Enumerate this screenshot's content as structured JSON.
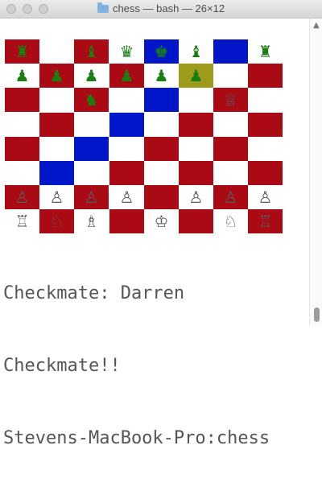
{
  "window": {
    "title": "chess — bash — 26×12"
  },
  "board": {
    "rows": [
      [
        {
          "bg": "r",
          "p": "♜",
          "c": "g"
        },
        {
          "bg": "w",
          "p": "",
          "c": ""
        },
        {
          "bg": "r",
          "p": "♝",
          "c": "g"
        },
        {
          "bg": "w",
          "p": "♛",
          "c": "g"
        },
        {
          "bg": "b",
          "p": "♚",
          "c": "g"
        },
        {
          "bg": "w",
          "p": "♝",
          "c": "g"
        },
        {
          "bg": "b",
          "p": "",
          "c": ""
        },
        {
          "bg": "w",
          "p": "♜",
          "c": "g"
        }
      ],
      [
        {
          "bg": "w",
          "p": "♟",
          "c": "g"
        },
        {
          "bg": "r",
          "p": "♟",
          "c": "g"
        },
        {
          "bg": "w",
          "p": "♟",
          "c": "g"
        },
        {
          "bg": "r",
          "p": "♟",
          "c": "g"
        },
        {
          "bg": "w",
          "p": "♟",
          "c": "g"
        },
        {
          "bg": "o",
          "p": "♟",
          "c": "g"
        },
        {
          "bg": "w",
          "p": "",
          "c": ""
        },
        {
          "bg": "r",
          "p": "",
          "c": ""
        }
      ],
      [
        {
          "bg": "r",
          "p": "",
          "c": ""
        },
        {
          "bg": "w",
          "p": "",
          "c": ""
        },
        {
          "bg": "r",
          "p": "♞",
          "c": "g"
        },
        {
          "bg": "w",
          "p": "",
          "c": ""
        },
        {
          "bg": "b",
          "p": "",
          "c": ""
        },
        {
          "bg": "w",
          "p": "",
          "c": ""
        },
        {
          "bg": "r",
          "p": "♕",
          "c": "k"
        },
        {
          "bg": "w",
          "p": "",
          "c": ""
        }
      ],
      [
        {
          "bg": "w",
          "p": "",
          "c": ""
        },
        {
          "bg": "r",
          "p": "",
          "c": ""
        },
        {
          "bg": "w",
          "p": "",
          "c": ""
        },
        {
          "bg": "b",
          "p": "",
          "c": ""
        },
        {
          "bg": "w",
          "p": "",
          "c": ""
        },
        {
          "bg": "r",
          "p": "",
          "c": ""
        },
        {
          "bg": "w",
          "p": "",
          "c": ""
        },
        {
          "bg": "r",
          "p": "",
          "c": ""
        }
      ],
      [
        {
          "bg": "r",
          "p": "",
          "c": ""
        },
        {
          "bg": "w",
          "p": "",
          "c": ""
        },
        {
          "bg": "b",
          "p": "",
          "c": ""
        },
        {
          "bg": "w",
          "p": "",
          "c": ""
        },
        {
          "bg": "r",
          "p": "",
          "c": ""
        },
        {
          "bg": "w",
          "p": "",
          "c": ""
        },
        {
          "bg": "r",
          "p": "",
          "c": ""
        },
        {
          "bg": "w",
          "p": "",
          "c": ""
        }
      ],
      [
        {
          "bg": "w",
          "p": "",
          "c": ""
        },
        {
          "bg": "b",
          "p": "",
          "c": ""
        },
        {
          "bg": "w",
          "p": "",
          "c": ""
        },
        {
          "bg": "r",
          "p": "",
          "c": ""
        },
        {
          "bg": "w",
          "p": "",
          "c": ""
        },
        {
          "bg": "r",
          "p": "",
          "c": ""
        },
        {
          "bg": "w",
          "p": "",
          "c": ""
        },
        {
          "bg": "r",
          "p": "",
          "c": ""
        }
      ],
      [
        {
          "bg": "r",
          "p": "♙",
          "c": "k"
        },
        {
          "bg": "w",
          "p": "♙",
          "c": "k"
        },
        {
          "bg": "r",
          "p": "♙",
          "c": "k"
        },
        {
          "bg": "w",
          "p": "♙",
          "c": "k"
        },
        {
          "bg": "r",
          "p": "",
          "c": ""
        },
        {
          "bg": "w",
          "p": "♙",
          "c": "k"
        },
        {
          "bg": "r",
          "p": "♙",
          "c": "k"
        },
        {
          "bg": "w",
          "p": "♙",
          "c": "k"
        }
      ],
      [
        {
          "bg": "w",
          "p": "♖",
          "c": "k"
        },
        {
          "bg": "r",
          "p": "♘",
          "c": "k"
        },
        {
          "bg": "w",
          "p": "♗",
          "c": "k"
        },
        {
          "bg": "r",
          "p": "",
          "c": ""
        },
        {
          "bg": "w",
          "p": "♔",
          "c": "k"
        },
        {
          "bg": "r",
          "p": "",
          "c": ""
        },
        {
          "bg": "w",
          "p": "♘",
          "c": "k"
        },
        {
          "bg": "r",
          "p": "♖",
          "c": "k"
        }
      ]
    ]
  },
  "terminal": {
    "lines": [
      "Checkmate: Darren",
      "Checkmate!!",
      "Stevens-MacBook-Pro:chess"
    ]
  }
}
